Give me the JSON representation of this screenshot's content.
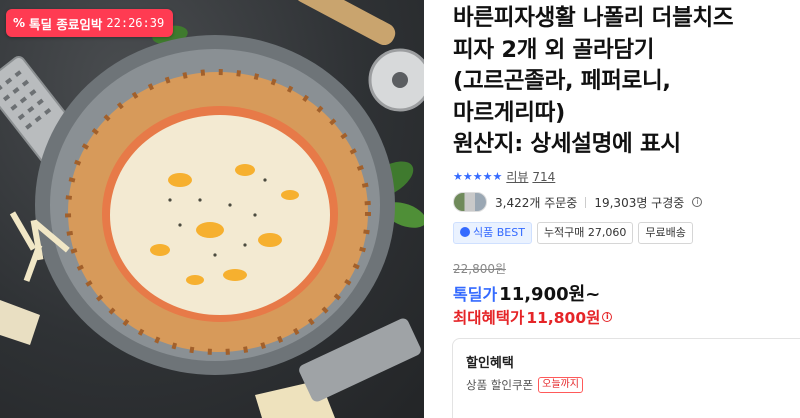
{
  "badge": {
    "icon": "percent-icon",
    "label": "톡딜 종료임박",
    "timer": "22:26:39",
    "color": "#ff3b52"
  },
  "product": {
    "title": "바른피자생활 나폴리 더블치즈\n피자 2개 외 골라담기\n(고르곤졸라, 페퍼로니,\n마르게리따)\n원산지: 상세설명에 표시"
  },
  "rating": {
    "stars": "★★★★★",
    "review_label": "리뷰",
    "review_count": "714",
    "accent": "#346aff"
  },
  "orders": {
    "ordering": "3,422개 주문중",
    "subscribers": "19,303명 구경중"
  },
  "tags": [
    {
      "label": "식품 BEST"
    },
    {
      "label": "누적구매 27,060"
    },
    {
      "label": "무료배송"
    }
  ],
  "price": {
    "original": "22,800원",
    "deal_label": "톡딜가",
    "deal_value": "11,900원~",
    "max_label": "최대혜택가",
    "max_value": "11,800원"
  },
  "benefit": {
    "header": "할인혜택",
    "coupon_label": "상품 할인쿠폰",
    "coupon_chip": "오늘까지"
  }
}
